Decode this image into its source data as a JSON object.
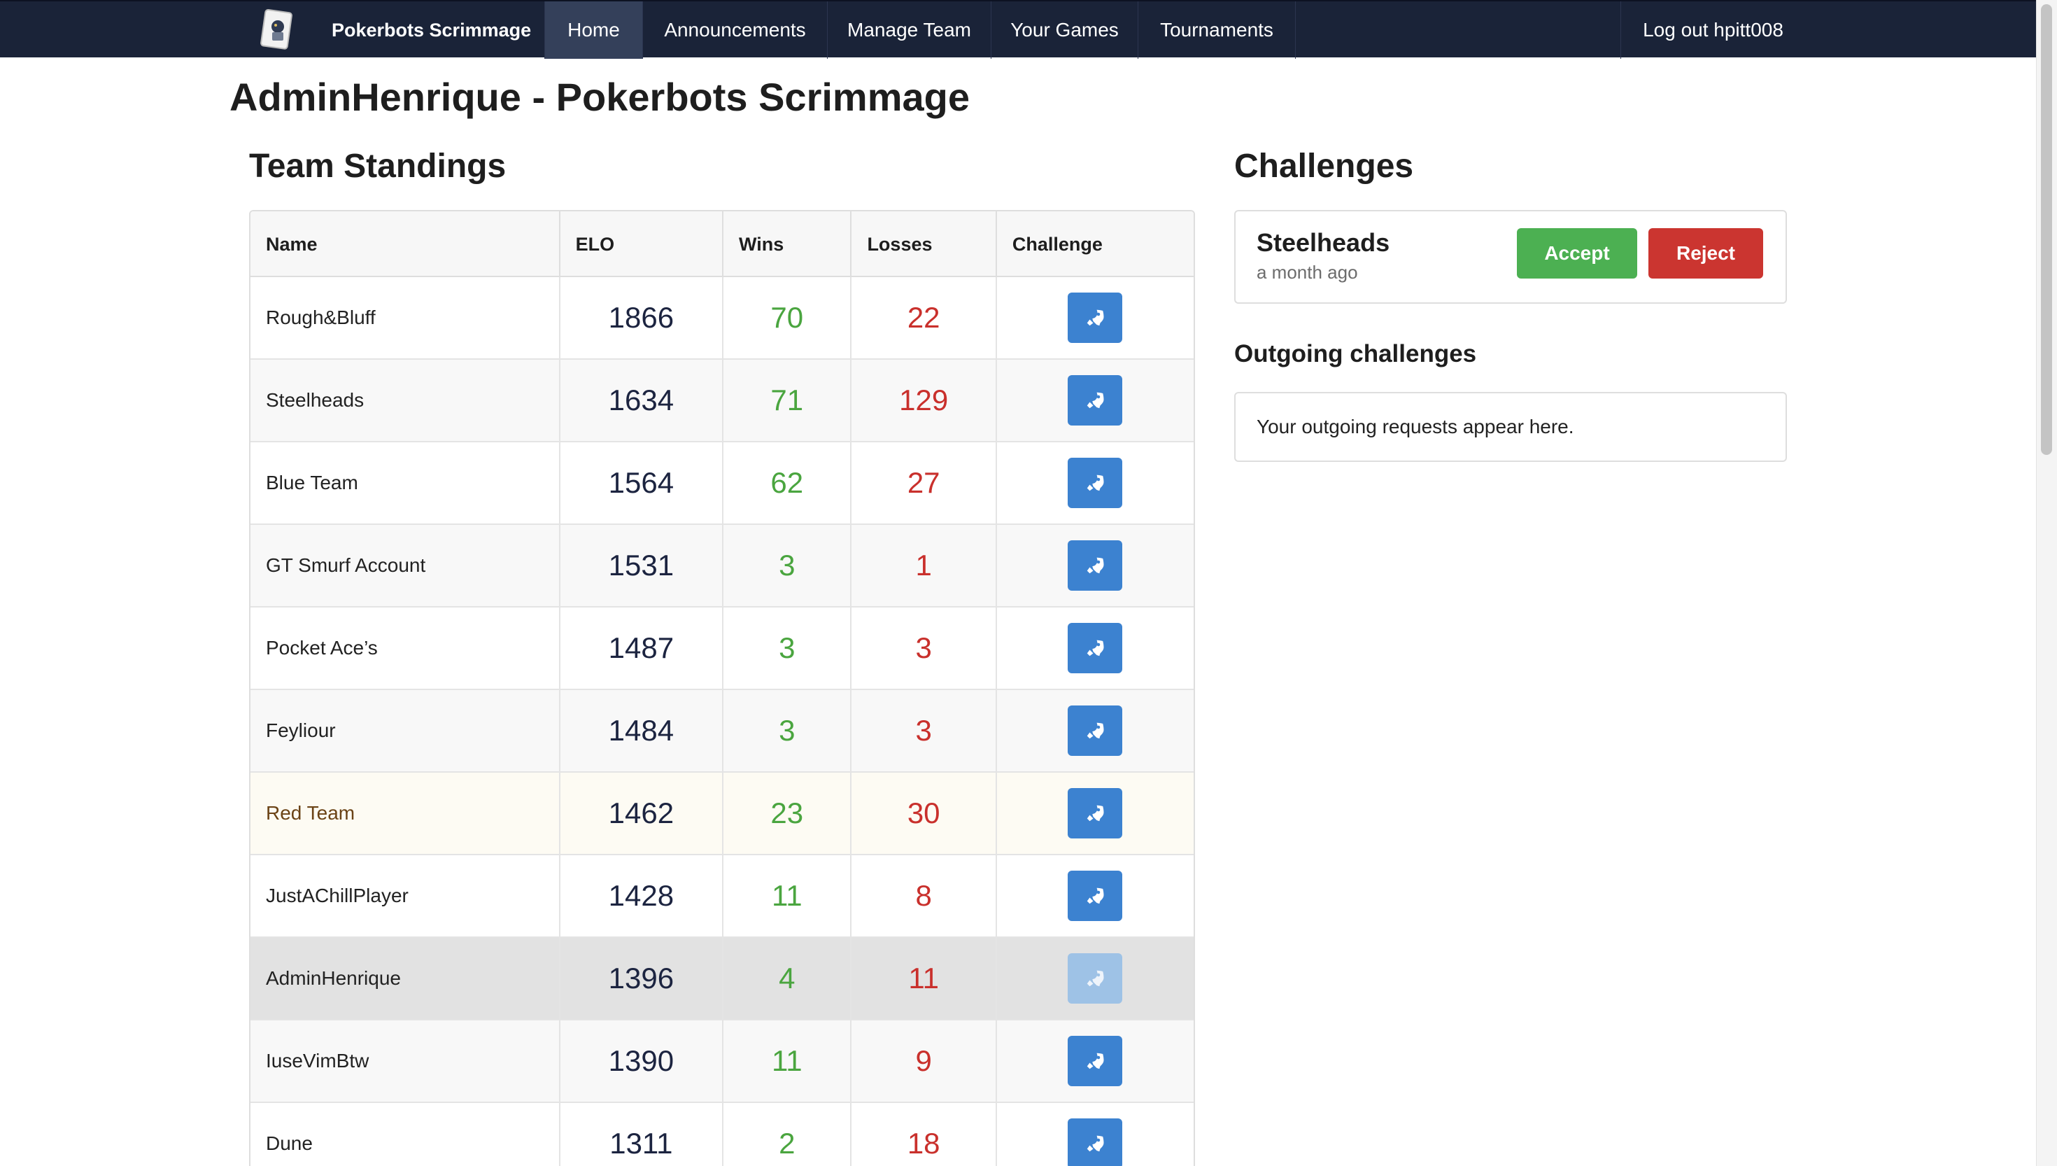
{
  "navbar": {
    "brand": "Pokerbots Scrimmage",
    "items": [
      {
        "label": "Home",
        "active": true
      },
      {
        "label": "Announcements",
        "active": false
      },
      {
        "label": "Manage Team",
        "active": false
      },
      {
        "label": "Your Games",
        "active": false
      },
      {
        "label": "Tournaments",
        "active": false
      }
    ],
    "logout": "Log out hpitt008"
  },
  "page": {
    "title": "AdminHenrique - Pokerbots Scrimmage"
  },
  "standings": {
    "title": "Team Standings",
    "columns": [
      "Name",
      "ELO",
      "Wins",
      "Losses",
      "Challenge"
    ],
    "rows": [
      {
        "name": "Rough&Bluff",
        "elo": "1866",
        "wins": "70",
        "losses": "22"
      },
      {
        "name": "Steelheads",
        "elo": "1634",
        "wins": "71",
        "losses": "129"
      },
      {
        "name": "Blue Team",
        "elo": "1564",
        "wins": "62",
        "losses": "27"
      },
      {
        "name": "GT Smurf Account",
        "elo": "1531",
        "wins": "3",
        "losses": "1"
      },
      {
        "name": "Pocket Ace’s",
        "elo": "1487",
        "wins": "3",
        "losses": "3"
      },
      {
        "name": "Feyliour",
        "elo": "1484",
        "wins": "3",
        "losses": "3"
      },
      {
        "name": "Red Team",
        "elo": "1462",
        "wins": "23",
        "losses": "30"
      },
      {
        "name": "JustAChillPlayer",
        "elo": "1428",
        "wins": "11",
        "losses": "8"
      },
      {
        "name": "AdminHenrique",
        "elo": "1396",
        "wins": "4",
        "losses": "11"
      },
      {
        "name": "IuseVimBtw",
        "elo": "1390",
        "wins": "11",
        "losses": "9"
      },
      {
        "name": "Dune",
        "elo": "1311",
        "wins": "2",
        "losses": "18"
      }
    ]
  },
  "challenges": {
    "title": "Challenges",
    "incoming": [
      {
        "team": "Steelheads",
        "time": "a month ago",
        "accept_label": "Accept",
        "reject_label": "Reject"
      }
    ],
    "outgoing_title": "Outgoing challenges",
    "outgoing_empty": "Your outgoing requests appear here."
  },
  "colors": {
    "navbar": "#1a2338",
    "wins": "#4aa53f",
    "losses": "#c9302c",
    "challenge_button": "#3c82d0",
    "accept": "#4cb052",
    "reject": "#cb3530"
  },
  "icons": {
    "logo": "playing-card-logo-icon",
    "challenge": "rocket-icon"
  }
}
